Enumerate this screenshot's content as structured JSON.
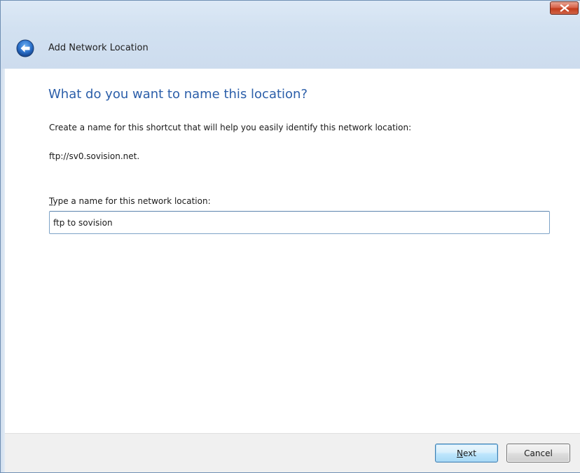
{
  "window": {
    "title": "Add Network Location",
    "close_icon": "close-icon",
    "back_icon": "back-arrow-icon"
  },
  "page": {
    "heading": "What do you want to name this location?",
    "description": "Create a name for this shortcut that will help you easily identify this network location:",
    "url": "ftp://sv0.sovision.net."
  },
  "name_field": {
    "label_accel": "T",
    "label_rest": "ype a name for this network location:",
    "value": "ftp to sovision"
  },
  "buttons": {
    "next_accel": "N",
    "next_rest": "ext",
    "cancel": "Cancel"
  },
  "colors": {
    "heading": "#2b5ea9",
    "glass": "#d2e1f1",
    "close_button": "#c23c1c"
  }
}
